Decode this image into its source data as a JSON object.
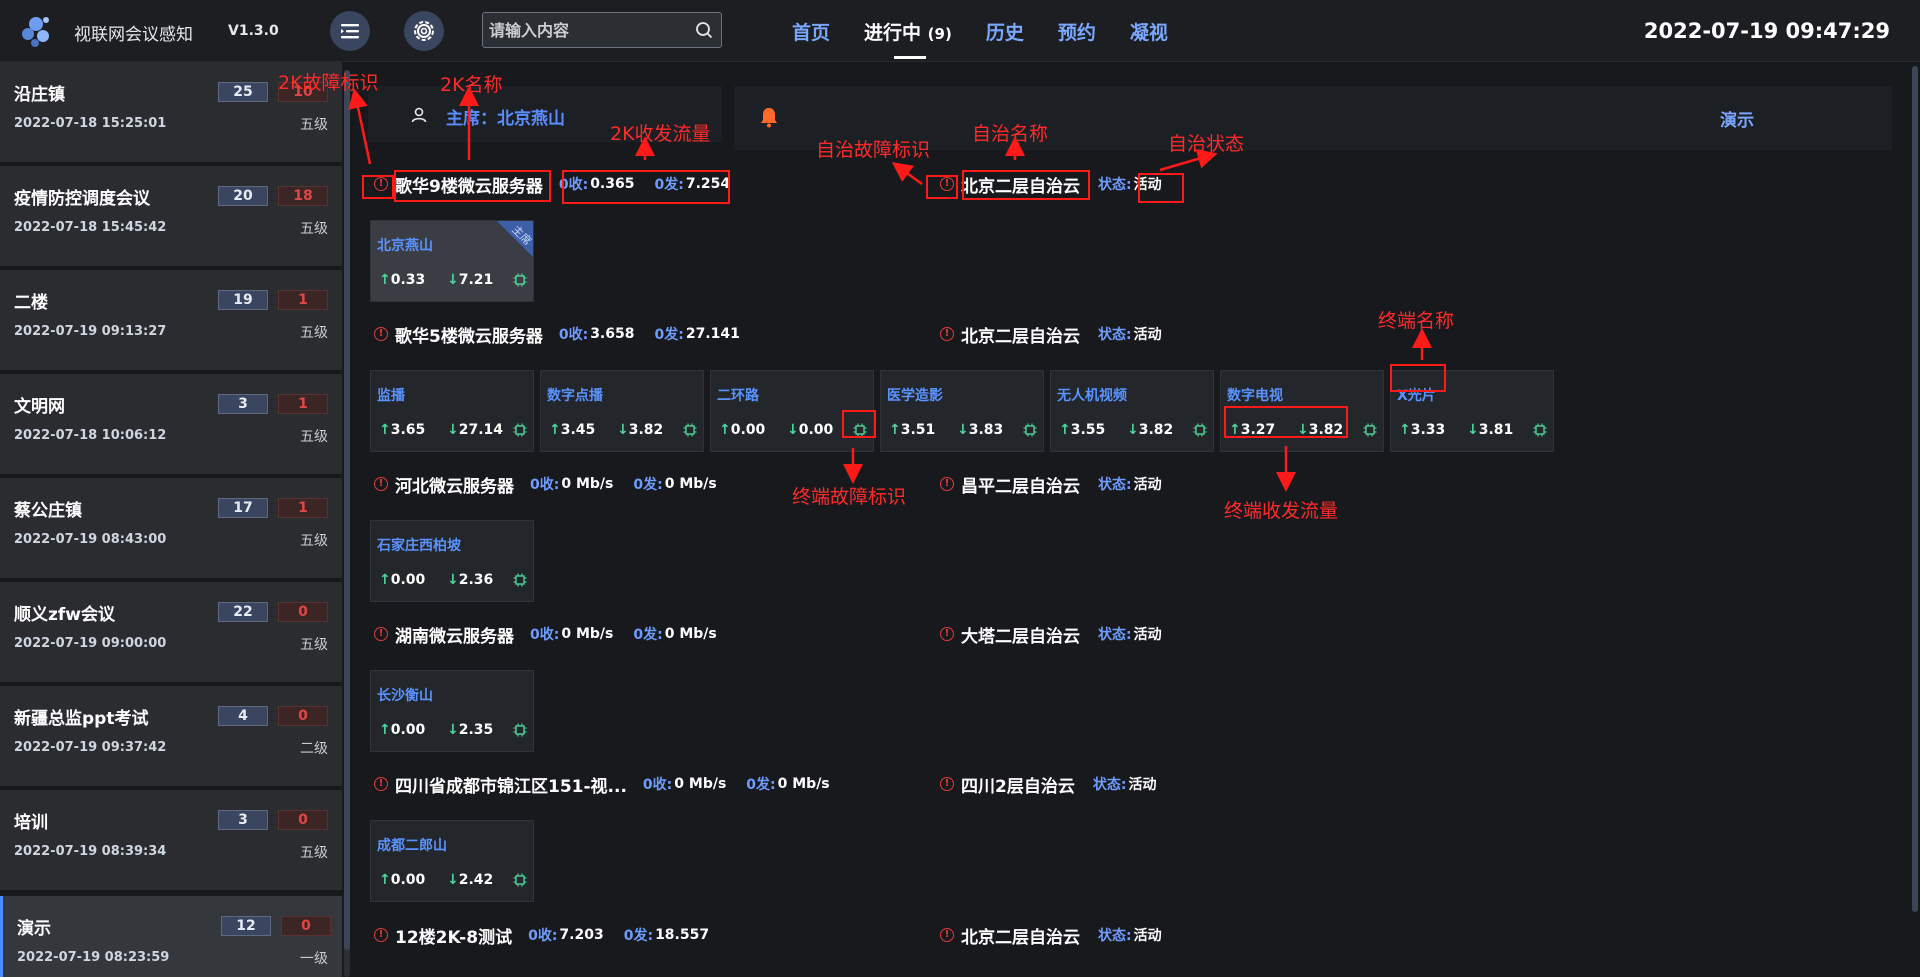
{
  "app": {
    "title": "视联网会议感知",
    "version": "V1.3.0"
  },
  "search": {
    "placeholder": "请输入内容"
  },
  "nav": {
    "home": "首页",
    "ongoing": "进行中",
    "ongoing_count": "(9)",
    "history": "历史",
    "booking": "预约",
    "watch": "凝视"
  },
  "clock": "2022-07-19 09:47:29",
  "meetings": [
    {
      "name": "沿庄镇",
      "time": "2022-07-18 15:25:01",
      "count_a": "25",
      "count_b": "10",
      "level": "五级"
    },
    {
      "name": "疫情防控调度会议",
      "time": "2022-07-18 15:45:42",
      "count_a": "20",
      "count_b": "18",
      "level": "五级"
    },
    {
      "name": "二楼",
      "time": "2022-07-19 09:13:27",
      "count_a": "19",
      "count_b": "1",
      "level": "五级"
    },
    {
      "name": "文明网",
      "time": "2022-07-18 10:06:12",
      "count_a": "3",
      "count_b": "1",
      "level": "五级"
    },
    {
      "name": "蔡公庄镇",
      "time": "2022-07-19 08:43:00",
      "count_a": "17",
      "count_b": "1",
      "level": "五级"
    },
    {
      "name": "顺义zfw会议",
      "time": "2022-07-19 09:00:00",
      "count_a": "22",
      "count_b": "0",
      "level": "五级"
    },
    {
      "name": "新疆总监ppt考试",
      "time": "2022-07-19 09:37:42",
      "count_a": "4",
      "count_b": "0",
      "level": "二级"
    },
    {
      "name": "培训",
      "time": "2022-07-19 08:39:34",
      "count_a": "3",
      "count_b": "0",
      "level": "五级"
    },
    {
      "name": "演示",
      "time": "2022-07-19 08:23:59",
      "count_a": "12",
      "count_b": "0",
      "level": "一级"
    }
  ],
  "host": {
    "label": "主席：北京燕山"
  },
  "demo": {
    "label": "演示"
  },
  "flow_labels": {
    "recv": "0收:",
    "send": "0发:",
    "state": "状态:"
  },
  "servers": [
    {
      "name": "歌华9楼微云服务器",
      "recv": "0.365",
      "send": "7.254",
      "auto_name": "北京二层自治云",
      "state": "活动",
      "terminals": [
        {
          "name": "北京燕山",
          "up": "0.33",
          "down": "7.21",
          "host_tag": "主席"
        }
      ]
    },
    {
      "name": "歌华5楼微云服务器",
      "recv": "3.658",
      "send": "27.141",
      "auto_name": "北京二层自治云",
      "state": "活动",
      "terminals": [
        {
          "name": "监播",
          "up": "3.65",
          "down": "27.14"
        },
        {
          "name": "数字点播",
          "up": "3.45",
          "down": "3.82"
        },
        {
          "name": "二环路",
          "up": "0.00",
          "down": "0.00"
        },
        {
          "name": "医学造影",
          "up": "3.51",
          "down": "3.83"
        },
        {
          "name": "无人机视频",
          "up": "3.55",
          "down": "3.82"
        },
        {
          "name": "数字电视",
          "up": "3.27",
          "down": "3.82"
        },
        {
          "name": "X光片",
          "up": "3.33",
          "down": "3.81"
        }
      ]
    },
    {
      "name": "河北微云服务器",
      "recv": "0 Mb/s",
      "send": "0 Mb/s",
      "auto_name": "昌平二层自治云",
      "state": "活动",
      "terminals": [
        {
          "name": "石家庄西柏坡",
          "up": "0.00",
          "down": "2.36"
        }
      ]
    },
    {
      "name": "湖南微云服务器",
      "recv": "0 Mb/s",
      "send": "0 Mb/s",
      "auto_name": "大塔二层自治云",
      "state": "活动",
      "terminals": [
        {
          "name": "长沙衡山",
          "up": "0.00",
          "down": "2.35"
        }
      ]
    },
    {
      "name": "四川省成都市锦江区151-视...",
      "recv": "0 Mb/s",
      "send": "0 Mb/s",
      "auto_name": "四川2层自治云",
      "state": "活动",
      "terminals": [
        {
          "name": "成都二郎山",
          "up": "0.00",
          "down": "2.42"
        }
      ]
    },
    {
      "name": "12楼2K-8测试",
      "recv": "7.203",
      "send": "18.557",
      "auto_name": "北京二层自治云",
      "state": "活动",
      "terminals": []
    }
  ],
  "annotations": {
    "fault_2k": "2K故障标识",
    "name_2k": "2K名称",
    "flow_2k": "2K收发流量",
    "fault_auto": "自治故障标识",
    "name_auto": "自治名称",
    "state_auto": "自治状态",
    "term_name": "终端名称",
    "term_fault": "终端故障标识",
    "term_flow": "终端收发流量"
  },
  "colors": {
    "accent": "#5a8dff",
    "fault": "#e23b3b",
    "annotation": "#ff1a1a",
    "flow_arrow": "#4fd39a"
  }
}
